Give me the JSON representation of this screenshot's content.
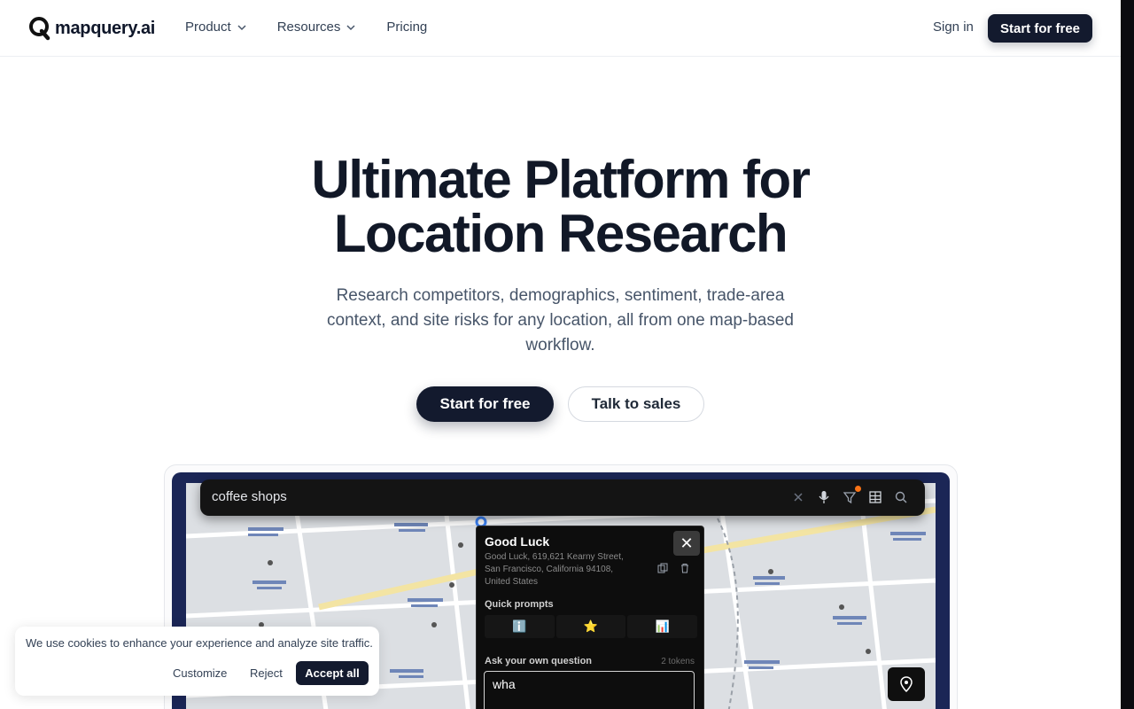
{
  "brand": {
    "name": "mapquery.ai"
  },
  "nav": {
    "items": [
      {
        "label": "Product",
        "has_dropdown": true
      },
      {
        "label": "Resources",
        "has_dropdown": true
      },
      {
        "label": "Pricing",
        "has_dropdown": false
      }
    ],
    "sign_in": "Sign in",
    "cta": "Start for free"
  },
  "hero": {
    "title_line1": "Ultimate Platform for",
    "title_line2": "Location Research",
    "subtitle": "Research competitors, demographics, sentiment, trade-area context, and site risks for any location, all from one map-based workflow.",
    "primary_cta": "Start for free",
    "secondary_cta": "Talk to sales"
  },
  "demo": {
    "search_value": "coffee shops",
    "popup": {
      "title": "Good Luck",
      "address": "Good Luck, 619,621 Kearny Street, San Francisco, California 94108, United States",
      "close_label": "✕",
      "quick_prompts_label": "Quick prompts",
      "quick_prompts": [
        "ℹ️",
        "⭐",
        "📊"
      ],
      "ask_label": "Ask your own question",
      "tokens": "2 tokens",
      "input_value": "wha"
    }
  },
  "cookie": {
    "message": "We use cookies to enhance your experience and analyze site traffic.",
    "customize": "Customize",
    "reject": "Reject",
    "accept": "Accept all"
  },
  "colors": {
    "primary": "#131a2e",
    "demo_bg": "#1b2656",
    "map_bg": "#dcdfe3",
    "filter_dot": "#f97316"
  }
}
